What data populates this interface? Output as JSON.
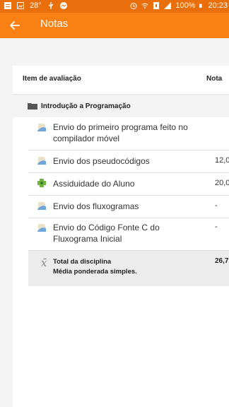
{
  "status_bar": {
    "temperature": "28°",
    "battery": "100%",
    "time": "20:23"
  },
  "app_bar": {
    "title": "Notas"
  },
  "table": {
    "col_item": "Item de avaliação",
    "col_grade": "Nota",
    "category": "Introdução a Programação",
    "items": [
      {
        "name": "Envio do primeiro programa feito no compilador móvel",
        "grade": "",
        "icon": "assignment-icon"
      },
      {
        "name": "Envio dos pseudocódigos",
        "grade": "12,0",
        "icon": "assignment-icon"
      },
      {
        "name": "Assiduidade do Aluno",
        "grade": "20,0",
        "icon": "attendance-icon"
      },
      {
        "name": "Envio dos fluxogramas",
        "grade": "-",
        "icon": "assignment-icon"
      },
      {
        "name": "Envio do Código Fonte C do Fluxograma Inicial",
        "grade": "-",
        "icon": "assignment-icon"
      }
    ],
    "total": {
      "label": "Total da disciplina",
      "sublabel": "Média ponderada simples.",
      "value": "26,7"
    }
  }
}
